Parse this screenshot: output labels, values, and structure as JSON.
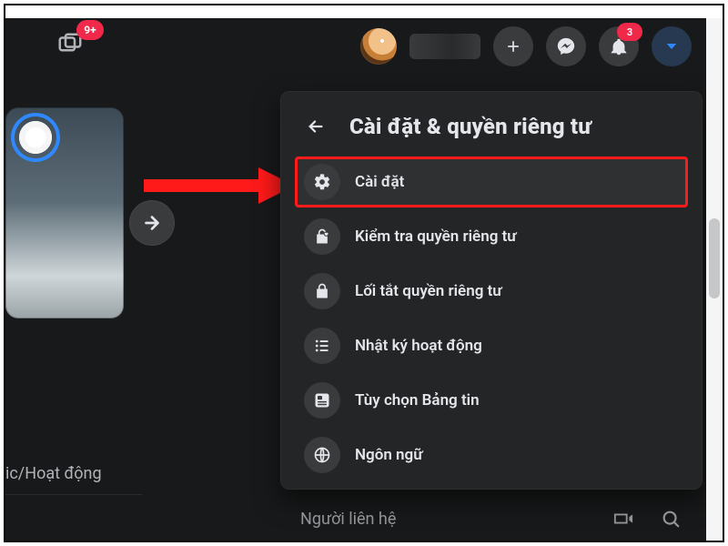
{
  "header": {
    "watch_badge": "9+",
    "notif_badge": "3"
  },
  "sidebar": {
    "tab_label": "ic/Hoạt động"
  },
  "dropdown": {
    "title": "Cài đặt & quyền riêng tư",
    "items": [
      {
        "key": "settings",
        "label": "Cài đặt"
      },
      {
        "key": "privacy_checkup",
        "label": "Kiểm tra quyền riêng tư"
      },
      {
        "key": "privacy_shortcuts",
        "label": "Lối tắt quyền riêng tư"
      },
      {
        "key": "activity_log",
        "label": "Nhật ký hoạt động"
      },
      {
        "key": "news_feed_prefs",
        "label": "Tùy chọn Bảng tin"
      },
      {
        "key": "language",
        "label": "Ngôn ngữ"
      }
    ]
  },
  "contacts": {
    "title": "Người liên hệ"
  },
  "colors": {
    "accent_blue": "#2e89ff",
    "badge_red": "#f02849",
    "highlight_red": "#ff1a1a",
    "panel_bg": "#242526",
    "app_bg": "#18191a"
  }
}
